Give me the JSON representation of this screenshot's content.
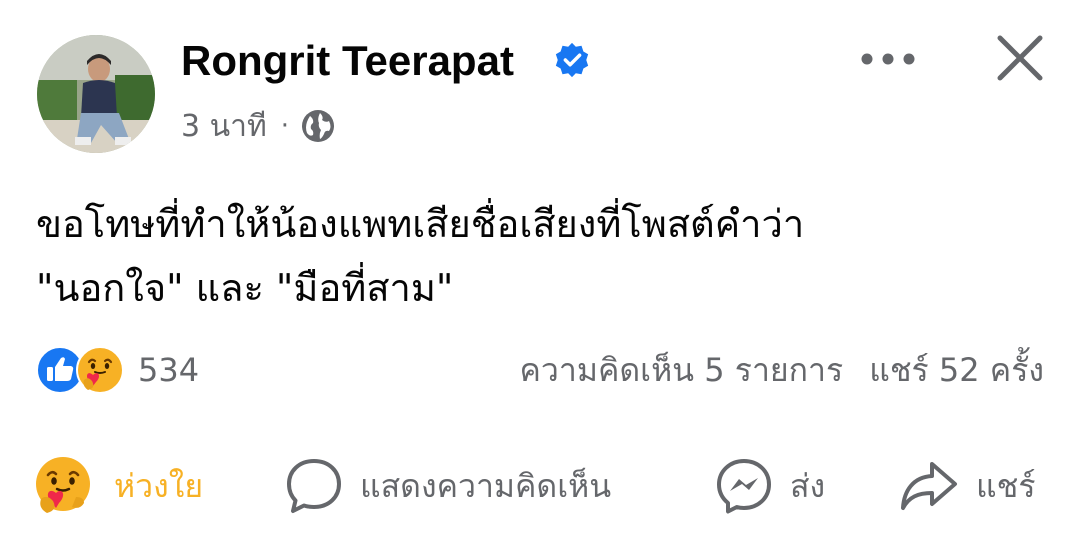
{
  "post": {
    "author": "Rongrit Teerapat",
    "time": "3 นาที",
    "separator": "·",
    "privacy_icon": "globe-icon",
    "text_lines": [
      "ขอโทษที่ทำให้น้องแพทเสียชื่อเสียงที่โพสต์คำว่า",
      "\"นอกใจ\" และ \"มือที่สาม\""
    ]
  },
  "reactions": {
    "icons": [
      "like-icon",
      "care-icon"
    ],
    "count": "534"
  },
  "stats": {
    "comments": "ความคิดเห็น 5 รายการ",
    "shares": "แชร์ 52 ครั้ง"
  },
  "actions": {
    "react_label": "ห่วงใย",
    "comment_label": "แสดงความคิดเห็น",
    "send_label": "ส่ง",
    "share_label": "แชร์"
  },
  "colors": {
    "brand_blue": "#1877f2",
    "care_yellow": "#f7b125",
    "secondary_text": "#65676b",
    "primary_text": "#050505"
  }
}
